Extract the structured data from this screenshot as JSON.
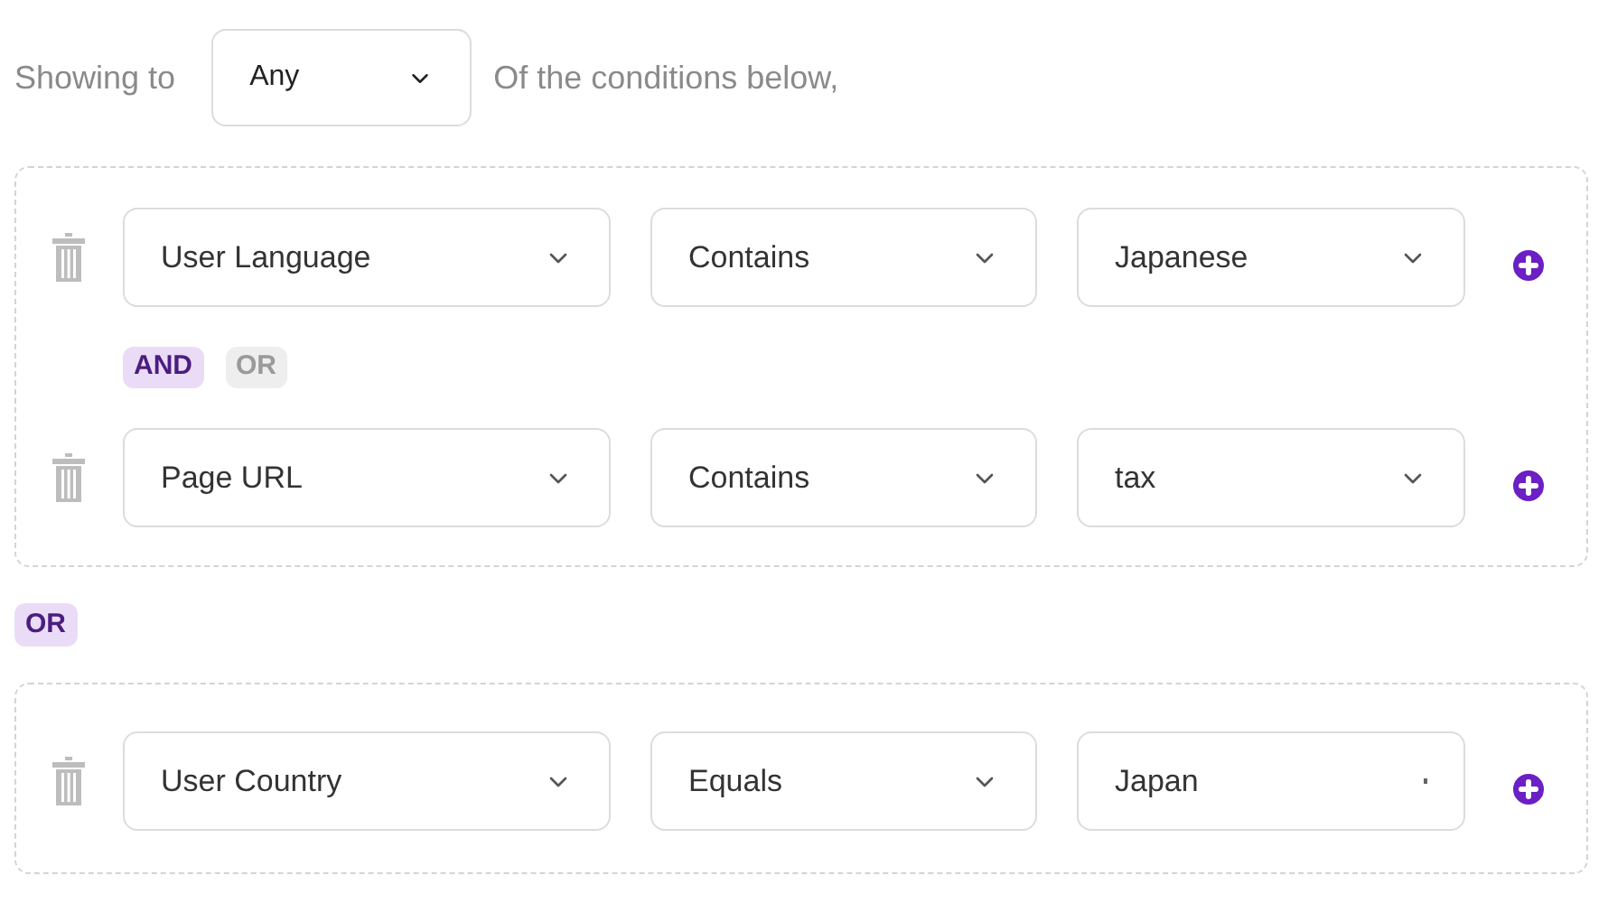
{
  "header": {
    "prefix": "Showing to",
    "match": "Any",
    "suffix": "Of the conditions below,"
  },
  "groups": [
    {
      "conditions": [
        {
          "field": "User Language",
          "operator": "Contains",
          "value": "Japanese",
          "kind": "select"
        },
        {
          "field": "Page URL",
          "operator": "Contains",
          "value": "tax",
          "kind": "select"
        }
      ],
      "joiners": [
        {
          "label": "AND",
          "selected": true
        },
        {
          "label": "OR",
          "selected": false
        }
      ]
    },
    {
      "conditions": [
        {
          "field": "User Country",
          "operator": "Equals",
          "value": "Japan",
          "kind": "input"
        }
      ]
    }
  ],
  "group_joiner": "OR"
}
